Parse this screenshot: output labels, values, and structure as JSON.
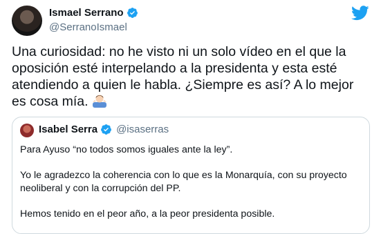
{
  "author": {
    "name": "Ismael Serrano",
    "handle": "@SerranoIsmael"
  },
  "tweet": {
    "text": "Una curiosidad: no he visto ni un solo vídeo en el que la oposición esté interpelando a la presidenta y esta esté atendiendo a quien le habla. ¿Siempre es así? A lo mejor es cosa mía. ",
    "emoji": "man-shrugging-icon"
  },
  "quoted": {
    "name": "Isabel Serra",
    "handle": "@isaserras",
    "lines": [
      "Para Ayuso “no todos somos iguales ante la ley”.",
      "Yo le agradezco la coherencia con lo que es la Monarquía, con su proyecto neoliberal y con la corrupción del PP.",
      "Hemos tenido en el peor año, a la peor presidenta posible."
    ]
  },
  "colors": {
    "twitter_blue": "#1da1f2",
    "secondary_text": "#5b7083",
    "border": "#cfd9de"
  }
}
